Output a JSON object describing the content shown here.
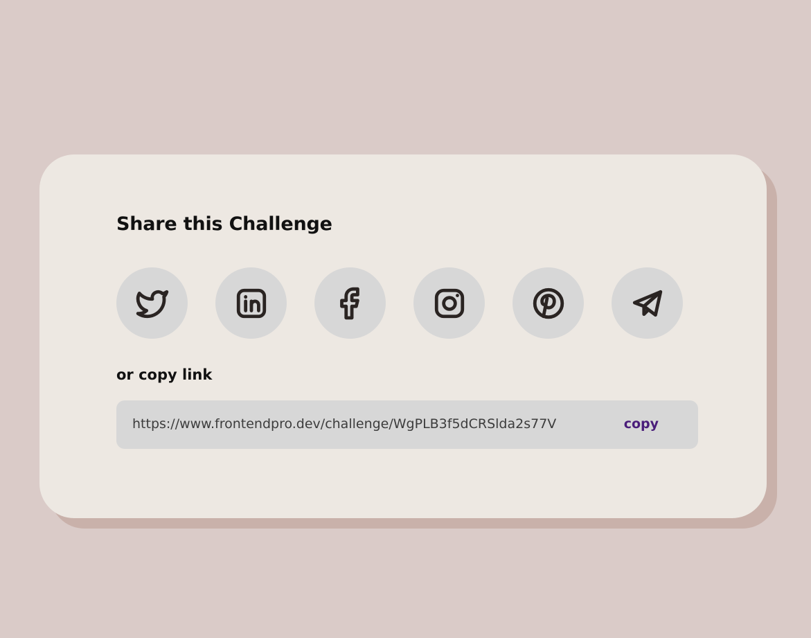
{
  "card": {
    "title": "Share this Challenge",
    "copy_label": "or copy link",
    "link_url": "https://www.frontendpro.dev/challenge/WgPLB3f5dCRSlda2s77V",
    "copy_button_label": "copy"
  },
  "share_icons": [
    {
      "icon": "twitter-icon"
    },
    {
      "icon": "linkedin-icon"
    },
    {
      "icon": "facebook-icon"
    },
    {
      "icon": "instagram-icon"
    },
    {
      "icon": "pinterest-icon"
    },
    {
      "icon": "telegram-icon"
    }
  ],
  "colors": {
    "background": "#dacbc8",
    "card": "#ede8e2",
    "card_shadow": "#c9b1aa",
    "icon_circle": "#d7d7d7",
    "copy_accent": "#4a1d7a"
  }
}
